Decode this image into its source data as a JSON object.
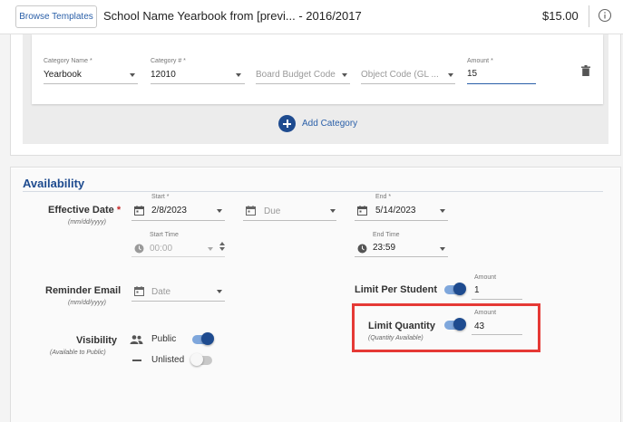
{
  "header": {
    "browse_label": "Browse Templates",
    "title": "School Name Yearbook from [previ...  - 2016/2017",
    "price": "$15.00",
    "info_icon": "info-icon"
  },
  "category": {
    "name_label": "Category Name *",
    "name_value": "Yearbook",
    "number_label": "Category # *",
    "number_value": "12010",
    "board_budget_placeholder": "Board Budget Code",
    "object_code_placeholder": "Object Code (GL ...",
    "amount_label": "Amount *",
    "amount_value": "15",
    "delete_icon": "trash-icon",
    "add_label": "Add Category"
  },
  "availability": {
    "title": "Availability",
    "effective_date": {
      "label": "Effective Date",
      "required_mark": "*",
      "format": "(mm/dd/yyyy)",
      "start_label": "Start *",
      "start_value": "2/8/2023",
      "due_placeholder": "Due",
      "end_label": "End *",
      "end_value": "5/14/2023",
      "start_time_label": "Start Time",
      "start_time_value": "00:00",
      "end_time_label": "End Time",
      "end_time_value": "23:59"
    },
    "reminder": {
      "label": "Reminder Email",
      "format": "(mm/dd/yyyy)",
      "date_placeholder": "Date"
    },
    "limit_per_student": {
      "label": "Limit Per Student",
      "amount_label": "Amount",
      "amount_value": "1",
      "enabled": true
    },
    "limit_quantity": {
      "label": "Limit Quantity",
      "sub": "(Quantity Available)",
      "amount_label": "Amount",
      "amount_value": "43",
      "enabled": true
    },
    "visibility": {
      "label": "Visibility",
      "sub": "(Available to Public)",
      "public_label": "Public",
      "public_enabled": true,
      "unlisted_label": "Unlisted",
      "unlisted_enabled": false
    }
  },
  "colors": {
    "brand_blue": "#1e4b8f",
    "link_blue": "#2a5fa8",
    "highlight_red": "#e53935",
    "required_red": "#c62828"
  }
}
